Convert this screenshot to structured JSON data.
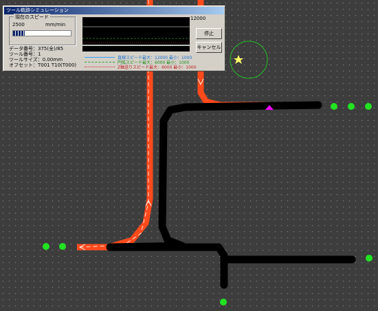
{
  "dialog": {
    "title": "ツール軌跡シミュレーション",
    "speed_group_label": "現在のスピード",
    "speed_value": "2500",
    "speed_unit": "mm/min",
    "progress_fraction": 0.2,
    "data_number": "データ番号：375(全)/85",
    "tool_number": "ツール番号：1",
    "tool_size": "ツールサイズ：0.00mm",
    "offset": "オフセット：T001 T10(T000)",
    "graph_max_value": "12000",
    "stop_button": "停止",
    "cancel_button": "キャンセル",
    "legend": [
      {
        "text": "直線スピード最大：12000 最小：1000",
        "color": "#3aa0ff",
        "style": "solid"
      },
      {
        "text": "円弧スピード最大：6000 最小：1000",
        "color": "#2ca02c",
        "style": "dashed"
      },
      {
        "text": "Z軸送りスピード最大：6000 最小：1000",
        "color": "#d03030",
        "style": "dotted"
      }
    ]
  },
  "colors": {
    "background": "#3d3d3d",
    "grid_dot": "#7a7a7a",
    "tool_path": "#ff4a1c",
    "routing_path": "#000000",
    "pad": "#22e322",
    "marker": "#ff00ff",
    "star": "#ffff66"
  },
  "icons": {
    "start_star": "star-icon",
    "target_ring": "circle-outline-icon"
  }
}
